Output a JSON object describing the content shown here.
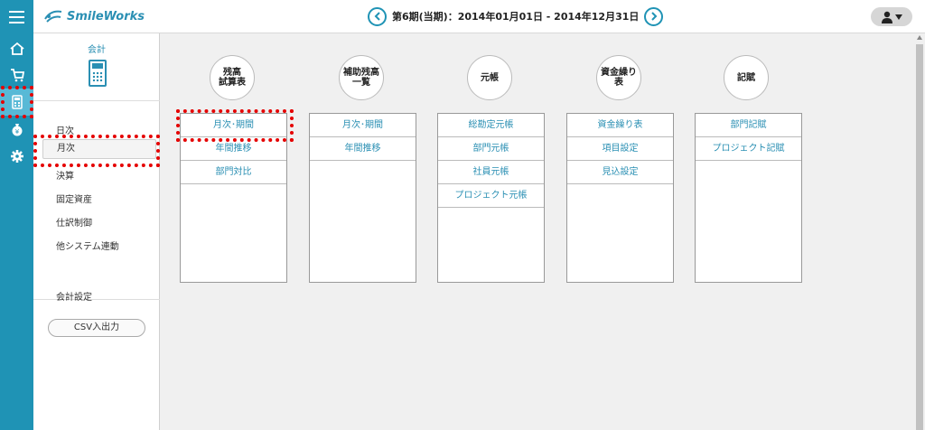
{
  "header": {
    "logo": "SmileWorks",
    "period": "第6期(当期)：2014年01月01日 - 2014年12月31日",
    "prev_icon": "chevron-left-icon",
    "next_icon": "chevron-right-icon",
    "user_icon": "user-icon"
  },
  "rail": {
    "items": [
      {
        "name": "home-icon"
      },
      {
        "name": "cart-icon"
      },
      {
        "name": "calculator-icon"
      },
      {
        "name": "money-bag-icon"
      },
      {
        "name": "gear-icon"
      }
    ]
  },
  "subnav": {
    "title": "会計",
    "items": [
      {
        "label": "日次"
      },
      {
        "label": "月次"
      },
      {
        "label": "決算"
      },
      {
        "label": "固定資産"
      },
      {
        "label": "仕訳制御"
      },
      {
        "label": "他システム連動"
      }
    ],
    "settings": "会計設定",
    "csv_button": "CSV入出力"
  },
  "columns": [
    {
      "title_line1": "残高",
      "title_line2": "試算表",
      "items": [
        "月次･期間",
        "年間推移",
        "部門対比"
      ]
    },
    {
      "title_line1": "補助残高",
      "title_line2": "一覧",
      "items": [
        "月次･期間",
        "年間推移"
      ]
    },
    {
      "title_line1": "元帳",
      "title_line2": "",
      "items": [
        "総勘定元帳",
        "部門元帳",
        "社員元帳",
        "プロジェクト元帳"
      ]
    },
    {
      "title_line1": "資金繰り",
      "title_line2": "表",
      "items": [
        "資金繰り表",
        "項目設定",
        "見込設定"
      ]
    },
    {
      "title_line1": "記賦",
      "title_line2": "",
      "items": [
        "部門記賦",
        "プロジェクト記賦"
      ]
    }
  ],
  "colors": {
    "accent": "#1f93b5",
    "link": "#2a8fb3",
    "highlight": "#e50000"
  }
}
